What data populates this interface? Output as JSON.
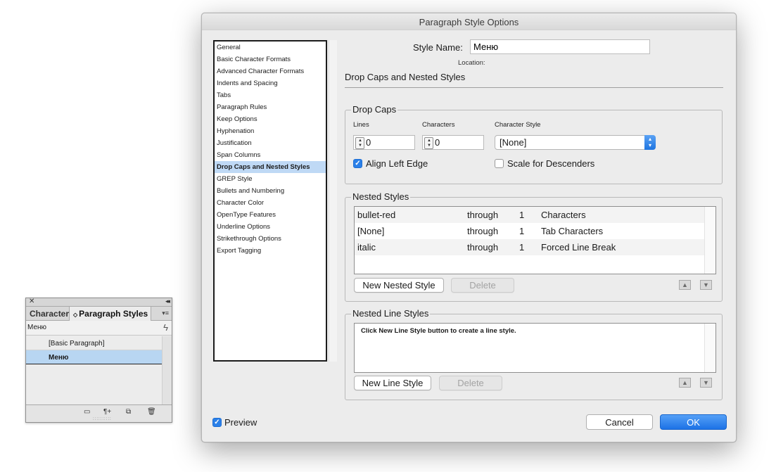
{
  "panel": {
    "tabs": [
      "Character S",
      "Paragraph Styles"
    ],
    "current_style": "Меню",
    "items": [
      "[Basic Paragraph]",
      "Меню"
    ],
    "selected_index": 1
  },
  "dialog": {
    "title": "Paragraph Style Options",
    "categories": [
      "General",
      "Basic Character Formats",
      "Advanced Character Formats",
      "Indents and Spacing",
      "Tabs",
      "Paragraph Rules",
      "Keep Options",
      "Hyphenation",
      "Justification",
      "Span Columns",
      "Drop Caps and Nested Styles",
      "GREP Style",
      "Bullets and Numbering",
      "Character Color",
      "OpenType Features",
      "Underline Options",
      "Strikethrough Options",
      "Export Tagging"
    ],
    "selected_category": "Drop Caps and Nested Styles",
    "style_name_label": "Style Name:",
    "style_name_value": "Меню",
    "location_label": "Location:",
    "section_title": "Drop Caps and Nested Styles",
    "drop_caps": {
      "title": "Drop Caps",
      "lines_label": "Lines",
      "lines_value": "0",
      "characters_label": "Characters",
      "characters_value": "0",
      "character_style_label": "Character Style",
      "character_style_value": "[None]",
      "align_left_edge_label": "Align Left Edge",
      "align_left_edge_checked": true,
      "scale_for_descenders_label": "Scale for Descenders",
      "scale_for_descenders_checked": false
    },
    "nested_styles": {
      "title": "Nested Styles",
      "rows": [
        {
          "style": "bullet-red",
          "mode": "through",
          "count": "1",
          "unit": "Characters"
        },
        {
          "style": "[None]",
          "mode": "through",
          "count": "1",
          "unit": "Tab Characters"
        },
        {
          "style": "italic",
          "mode": "through",
          "count": "1",
          "unit": "Forced Line Break"
        }
      ],
      "new_button": "New Nested Style",
      "delete_button": "Delete"
    },
    "nested_line_styles": {
      "title": "Nested Line Styles",
      "hint": "Click New Line Style button to create a line style.",
      "new_button": "New Line Style",
      "delete_button": "Delete"
    },
    "preview_label": "Preview",
    "preview_checked": true,
    "cancel_button": "Cancel",
    "ok_button": "OK"
  },
  "colors": {
    "accent": "#2b80e8",
    "selection": "#bfd9f5"
  }
}
